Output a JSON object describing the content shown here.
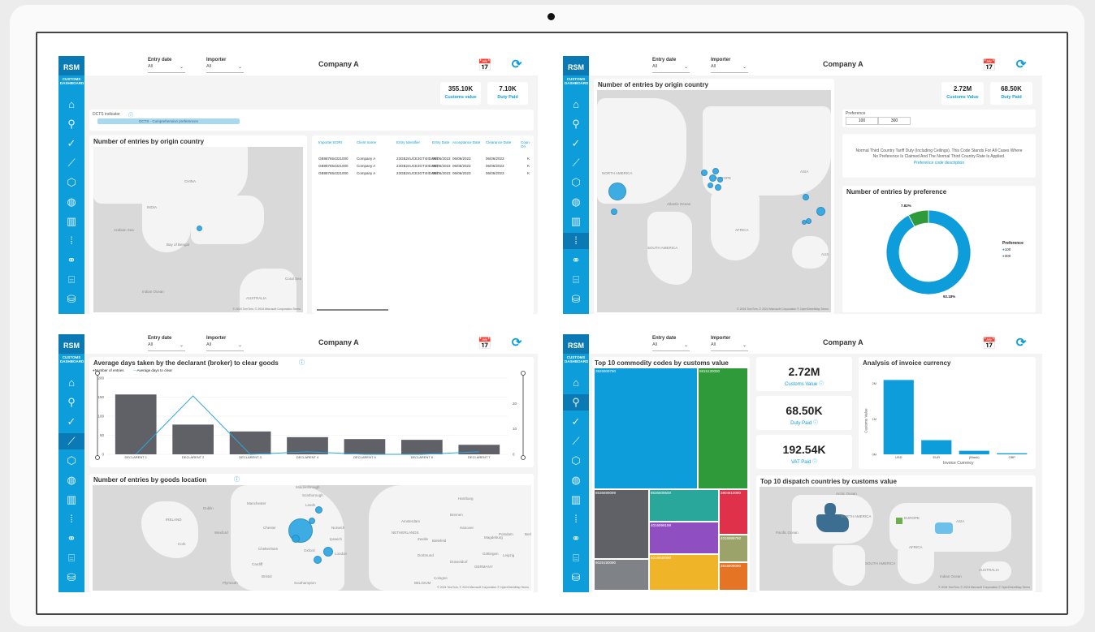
{
  "app": {
    "logo_text": "RSM",
    "logo_sub": "CUSTOMS DASHBOARD",
    "company": "Company A"
  },
  "filters": {
    "entry_date_label": "Entry date",
    "entry_date_value": "All",
    "importer_label": "Importer",
    "importer_value": "All"
  },
  "nav_icons": [
    "home-icon",
    "search-icon",
    "check-circle-icon",
    "line-chart-icon",
    "box-icon",
    "globe-icon",
    "barcode-icon",
    "binary-icon",
    "handshake-icon",
    "bank-icon",
    "database-icon"
  ],
  "panel1": {
    "kpis": [
      {
        "value": "355.10K",
        "label": "Customs value"
      },
      {
        "value": "7.10K",
        "label": "Duty Paid"
      }
    ],
    "dcts_label": "DCTS indicator",
    "dcts_value": "DCTS - Comprehensive preferences",
    "map_title": "Number of entries by origin country",
    "map_labels": [
      "CHINA",
      "INDIA",
      "Arabian Sea",
      "Bay of Bengal",
      "Indian Ocean",
      "AUSTRALIA",
      "Coral Sea"
    ],
    "map_footer": "© 2024 TomTom, © 2024 Microsoft Corporation  Terms",
    "table_headers": [
      "Importer EORI",
      "Client name",
      "Entry Identifier",
      "Entry Date",
      "Acceptance Date",
      "Clearance Date",
      "Coun Ori"
    ],
    "table_rows": [
      [
        "GB987654321000",
        "Company A",
        "23GB24UCE3GT4IIDAR7",
        "06/06/2023",
        "06/06/2023",
        "06/06/2023",
        "K"
      ],
      [
        "GB987654321000",
        "Company A",
        "23GB24UCE3GT4IIDAR7",
        "06/06/2023",
        "06/06/2023",
        "06/06/2023",
        "K"
      ],
      [
        "GB987654321000",
        "Company A",
        "23GB24UCE3GT4IIDAR7",
        "06/06/2023",
        "06/06/2023",
        "06/06/2023",
        "K"
      ]
    ]
  },
  "panel2": {
    "map_title": "Number of entries by origin country",
    "map_labels": [
      "NORTH AMERICA",
      "EUROPE",
      "ASIA",
      "AFRICA",
      "SOUTH AMERICA",
      "Atlantic Ocean",
      "AUS"
    ],
    "map_footer": "© 2024 TomTom, © 2024 Microsoft Corporation  © OpenStreetMap  Terms",
    "kpis": [
      {
        "value": "2.72M",
        "label": "Customs Value"
      },
      {
        "value": "68.50K",
        "label": "Duty Paid"
      }
    ],
    "preference_label": "Preference",
    "preference_options": [
      "100",
      "300"
    ],
    "description": "Normal Third Country Tariff Duty (Including Ceilings). This Code Stands For All Cases Where No Preference Is Claimed And The Normal Third Country Rate Is Applied.",
    "description_link": "Preference code description",
    "donut_title": "Number of entries by preference",
    "legend_title": "Preference",
    "legend": [
      {
        "name": "100",
        "color": "#0d9ddb"
      },
      {
        "name": "300",
        "color": "#2e9a3a"
      }
    ],
    "label_small": "7.82%",
    "label_large": "92.18%"
  },
  "panel3": {
    "chart_title": "Average days taken by the declarant (broker) to clear goods",
    "legend": [
      {
        "name": "Number of entries",
        "color": "#5f6167"
      },
      {
        "name": "Average days to clear",
        "color": "#2aa5e2"
      }
    ],
    "map_title": "Number of entries by goods location",
    "map_labels": [
      "Middlesbrough",
      "Scarborough",
      "Dublin",
      "IRELAND",
      "Manchester",
      "Leeds",
      "Chester",
      "Wexford",
      "Cork",
      "Cardiff",
      "Bristol",
      "Oxford",
      "Norwich",
      "Ipswich",
      "London",
      "Southampton",
      "Amsterdam",
      "NETHERLANDS",
      "Hamburg",
      "Bremen",
      "Hanover",
      "Magdeburg",
      "Bielefeld",
      "Göttingen",
      "Düsseldorf",
      "GERMANY",
      "Leipzig",
      "Cologne",
      "BELGIUM",
      "Potsdam",
      "Berl",
      "Dortmund",
      "Zwolle",
      "Cheltenham",
      "Plymouth"
    ],
    "map_footer": "© 2024 TomTom, © 2024 Microsoft Corporation  © OpenStreetMap  Terms"
  },
  "panel4": {
    "treemap_title": "Top 10 commodity codes by customs value",
    "treemap": [
      {
        "code": "3926909790",
        "color": "#0d9ddb"
      },
      {
        "code": "6815130000",
        "color": "#2e9a3a"
      },
      {
        "code": "8536699099",
        "color": "#5f6167"
      },
      {
        "code": "8536609500",
        "color": "#2aa79b"
      },
      {
        "code": "3904610090",
        "color": "#e0314b"
      },
      {
        "code": "4016999199",
        "color": "#8f4fc1"
      },
      {
        "code": "4016999790",
        "color": "#9ba36b"
      },
      {
        "code": "9025190090",
        "color": "#7f8287"
      },
      {
        "code": "4016930090",
        "color": "#f0b429"
      },
      {
        "code": "3916909090",
        "color": "#e67425"
      }
    ],
    "kpis": [
      {
        "value": "2.72M",
        "label": "Customs Value"
      },
      {
        "value": "68.50K",
        "label": "Duty Paid"
      },
      {
        "value": "192.54K",
        "label": "VAT Paid"
      }
    ],
    "bar_title": "Analysis of invoice currency",
    "bar_xlabel": "Invoice Currency",
    "bar_ylabel": "Customs Value",
    "bottom_map_title": "Top 10 dispatch countries by customs value",
    "bottom_map_labels": [
      "Arctic Ocean",
      "NORTH AMERICA",
      "EUROPE",
      "ASIA",
      "AFRICA",
      "SOUTH AMERICA",
      "AUSTRALIA",
      "Pacific Ocean",
      "Indian Ocean"
    ],
    "map_footer": "© 2024 TomTom, © 2024 Microsoft Corporation  © OpenStreetMap  Terms"
  },
  "chart_data": [
    {
      "type": "bar",
      "title": "Average days taken by the declarant (broker) to clear goods",
      "categories": [
        "DECLARENT 1",
        "DECLARENT 2",
        "DECLARENT 3",
        "DECLARENT 4",
        "DECLARENT 5",
        "DECLARENT 6",
        "DECLARENT 7"
      ],
      "series": [
        {
          "name": "Number of entries",
          "type": "bar",
          "values": [
            157,
            78,
            60,
            45,
            40,
            38,
            25
          ]
        },
        {
          "name": "Average days to clear",
          "type": "line",
          "values": [
            0,
            23,
            0,
            1,
            0,
            0,
            1
          ]
        }
      ],
      "ylim": [
        0,
        200
      ],
      "y2lim": [
        0,
        30
      ],
      "yticks": [
        0,
        50,
        100,
        150,
        200
      ],
      "y2ticks": [
        0,
        10,
        20
      ]
    },
    {
      "type": "bar",
      "title": "Analysis of invoice currency",
      "xlabel": "Invoice Currency",
      "ylabel": "Customs Value",
      "categories": [
        "USD",
        "EUR",
        "(Blank)",
        "GBP"
      ],
      "values": [
        2.1,
        0.4,
        0.1,
        0.03
      ],
      "ylim": [
        0,
        2.2
      ],
      "yticks": [
        "0M",
        "1M",
        "2M"
      ]
    },
    {
      "type": "pie",
      "title": "Number of entries by preference",
      "categories": [
        "100",
        "300"
      ],
      "values": [
        92.18,
        7.82
      ]
    }
  ]
}
